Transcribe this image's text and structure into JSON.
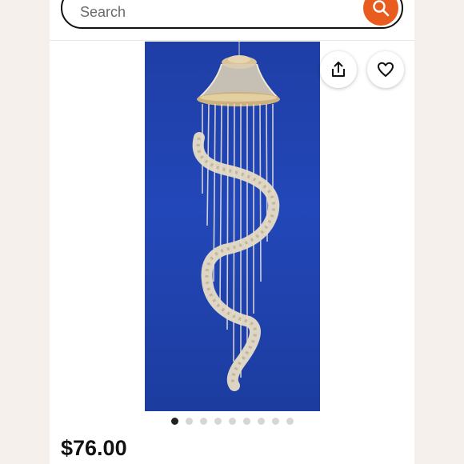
{
  "search": {
    "placeholder": "Search"
  },
  "listing": {
    "price": "$76.00",
    "image_count": 9,
    "active_image_index": 0
  },
  "colors": {
    "accent": "#e85d1f",
    "photo_background": "#2247b8"
  },
  "icons": {
    "search": "search-icon",
    "share": "share-icon",
    "favorite": "heart-icon"
  }
}
